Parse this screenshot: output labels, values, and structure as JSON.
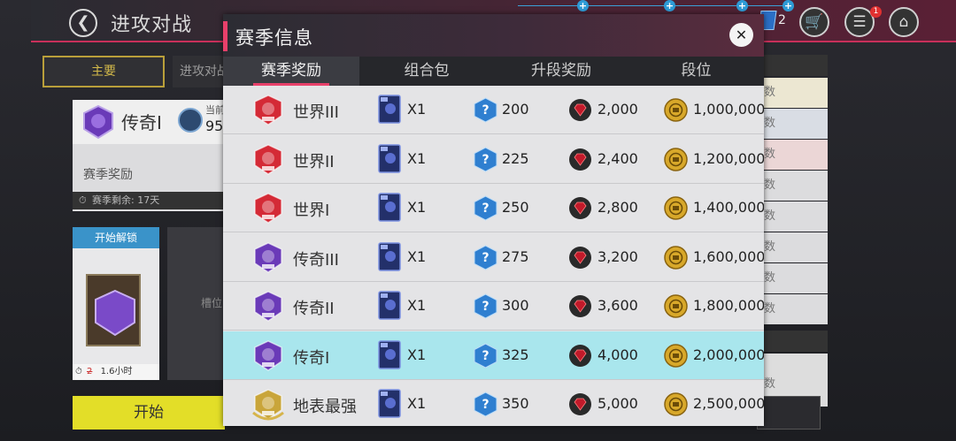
{
  "page": {
    "title": "进攻对战",
    "currency_count": "2",
    "notification_count": "1"
  },
  "background": {
    "tabs": [
      "主要",
      "进攻对战"
    ],
    "rank_name": "传奇I",
    "rank_meta_label": "当前",
    "rank_meta_value": "95",
    "season_reward_label": "赛季奖励",
    "season_remaining": "赛季剩余: 17天",
    "unlock_label": "开始解锁",
    "unlock_timer": "1.6小时",
    "unlock_timer_old": "2",
    "slot_label": "槽位",
    "start_button": "开始",
    "right_column_suffix": [
      "数",
      "数",
      "数",
      "数",
      "数",
      "数",
      "数",
      "数",
      "数"
    ]
  },
  "modal": {
    "title": "赛季信息",
    "tabs": [
      {
        "label": "赛季奖励",
        "active": true
      },
      {
        "label": "组合包",
        "active": false
      },
      {
        "label": "升段奖励",
        "active": false
      },
      {
        "label": "段位",
        "active": false
      }
    ],
    "rows": [
      {
        "rank": "世界III",
        "tier": "world",
        "card_qty": "X1",
        "packs": "200",
        "gems": "2,000",
        "coins": "1,000,000",
        "highlight": false
      },
      {
        "rank": "世界II",
        "tier": "world",
        "card_qty": "X1",
        "packs": "225",
        "gems": "2,400",
        "coins": "1,200,000",
        "highlight": false
      },
      {
        "rank": "世界I",
        "tier": "world",
        "card_qty": "X1",
        "packs": "250",
        "gems": "2,800",
        "coins": "1,400,000",
        "highlight": false
      },
      {
        "rank": "传奇III",
        "tier": "legend",
        "card_qty": "X1",
        "packs": "275",
        "gems": "3,200",
        "coins": "1,600,000",
        "highlight": false
      },
      {
        "rank": "传奇II",
        "tier": "legend",
        "card_qty": "X1",
        "packs": "300",
        "gems": "3,600",
        "coins": "1,800,000",
        "highlight": false
      },
      {
        "rank": "传奇I",
        "tier": "legend",
        "card_qty": "X1",
        "packs": "325",
        "gems": "4,000",
        "coins": "2,000,000",
        "highlight": true
      },
      {
        "rank": "地表最强",
        "tier": "strongest",
        "card_qty": "X1",
        "packs": "350",
        "gems": "5,000",
        "coins": "2,500,000",
        "highlight": false
      }
    ]
  },
  "colors": {
    "accent_pink": "#e8406a",
    "highlight_row": "#a9e6ed",
    "start_button": "#e3de28",
    "world_emblem": "#d42a36",
    "legend_emblem": "#6a3ab8",
    "strongest_emblem": "#c9a53a",
    "pack_blue": "#2f7fd0",
    "gem_red": "#c21a2a",
    "coin_gold": "#d8a82a"
  },
  "icons": [
    "back-arrow-icon",
    "plus-icon",
    "shop-cart-icon",
    "task-list-icon",
    "home-icon",
    "close-icon",
    "rank-emblem-icon",
    "player-card-icon",
    "mystery-pack-icon",
    "gem-icon",
    "coin-icon",
    "stopwatch-icon"
  ]
}
